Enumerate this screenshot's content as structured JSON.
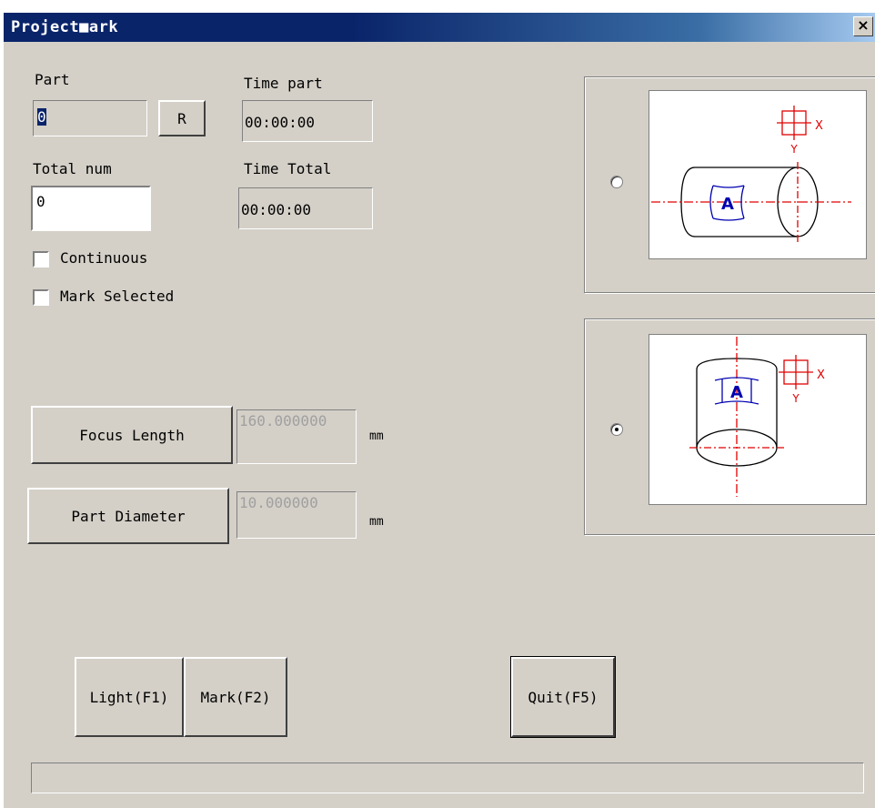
{
  "window": {
    "title": "Project■ark",
    "close_label": "×"
  },
  "part": {
    "label": "Part",
    "value": "0",
    "reset_label": "R"
  },
  "time_part": {
    "label": "Time part",
    "value": "00:00:00"
  },
  "total_num": {
    "label": "Total num",
    "value": "0"
  },
  "time_total": {
    "label": "Time Total",
    "value": "00:00:00"
  },
  "options": {
    "continuous_label": "Continuous",
    "continuous_checked": false,
    "mark_selected_label": "Mark Selected",
    "mark_selected_checked": false
  },
  "focus": {
    "button_label": "Focus Length",
    "value": "160.000000",
    "unit": "mm"
  },
  "diameter": {
    "button_label": "Part Diameter",
    "value": "10.000000",
    "unit": "mm"
  },
  "orientation": {
    "horizontal_selected": false,
    "vertical_selected": true,
    "axis_x_label": "X",
    "axis_y_label": "Y",
    "mark_letter": "A"
  },
  "buttons": {
    "light_label": "Light(F1)",
    "mark_label": "Mark(F2)",
    "quit_label": "Quit(F5)"
  },
  "progress": {
    "value": 0
  },
  "colors": {
    "axis": "#e00000",
    "mark": "#0000b0",
    "title_bar": "#0a246a",
    "face": "#d4d0c8"
  },
  "icons": [
    "close-icon",
    "horizontal-cylinder-diagram",
    "vertical-cylinder-diagram"
  ]
}
